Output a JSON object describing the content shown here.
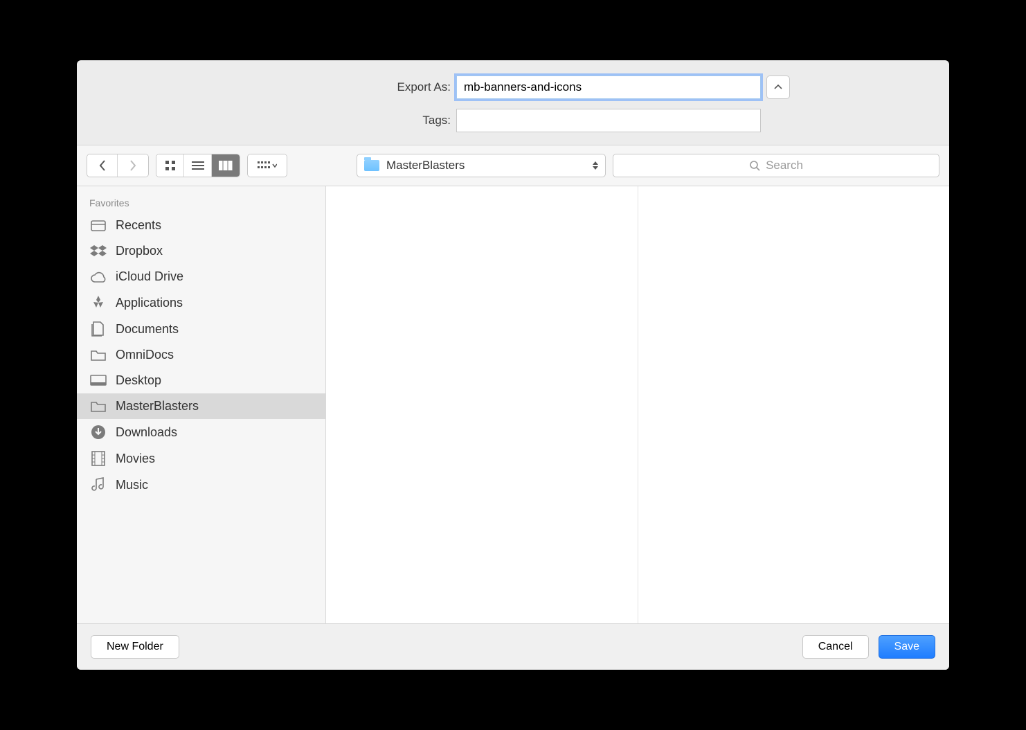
{
  "header": {
    "export_label": "Export As:",
    "filename": "mb-banners-and-icons",
    "tags_label": "Tags:",
    "tags_value": ""
  },
  "toolbar": {
    "current_folder": "MasterBlasters",
    "search_placeholder": "Search"
  },
  "sidebar": {
    "heading": "Favorites",
    "items": [
      {
        "icon": "recents",
        "label": "Recents"
      },
      {
        "icon": "dropbox",
        "label": "Dropbox"
      },
      {
        "icon": "icloud",
        "label": "iCloud Drive"
      },
      {
        "icon": "applications",
        "label": "Applications"
      },
      {
        "icon": "documents",
        "label": "Documents"
      },
      {
        "icon": "folder",
        "label": "OmniDocs"
      },
      {
        "icon": "desktop",
        "label": "Desktop"
      },
      {
        "icon": "folder",
        "label": "MasterBlasters",
        "selected": true
      },
      {
        "icon": "downloads",
        "label": "Downloads"
      },
      {
        "icon": "movies",
        "label": "Movies"
      },
      {
        "icon": "music",
        "label": "Music"
      }
    ]
  },
  "footer": {
    "new_folder": "New Folder",
    "cancel": "Cancel",
    "save": "Save"
  }
}
